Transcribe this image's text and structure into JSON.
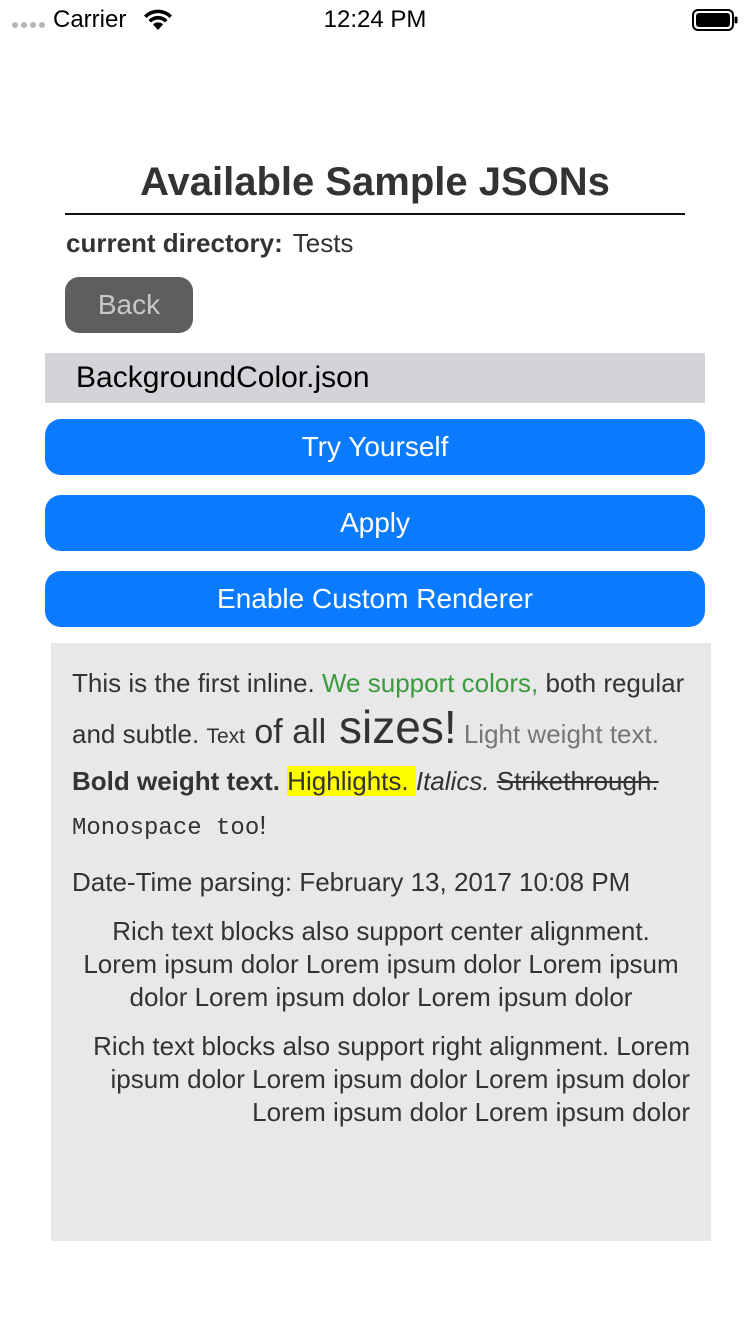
{
  "status_bar": {
    "carrier": "Carrier",
    "time": "12:24 PM"
  },
  "header": {
    "title": "Available Sample JSONs",
    "current_directory_label": "current directory:",
    "current_directory_value": "Tests"
  },
  "back_button": {
    "label": "Back"
  },
  "file": {
    "name": "BackgroundColor.json"
  },
  "buttons": {
    "try_yourself": "Try Yourself",
    "apply": "Apply",
    "custom_renderer": "Enable Custom Renderer"
  },
  "colors": {
    "accent_blue": "#0a7aff",
    "highlight": "#ffff00",
    "green_text": "#3a9a3f",
    "card_bg": "#e8e8e8",
    "file_row_bg": "#d3d3d8"
  },
  "card": {
    "rich": {
      "t1": "This is the first inline. ",
      "t2": "We support colors,",
      "t3": " both regular and subtle. ",
      "t4": "Text",
      "t5": " of ",
      "t6": "all",
      "t7": " sizes!",
      "t8": " Light weight text. ",
      "t9": "Bold weight text.",
      "t10": " ",
      "t11": "Highlights. ",
      "t12": "Italics.",
      "t13": " ",
      "t14": "Strikethrough. ",
      "t15": "Monospace too",
      "t16": "!"
    },
    "date_line": "Date-Time parsing: February 13, 2017 10:08 PM",
    "center_text": "Rich text blocks also support center alignment. Lorem ipsum dolor Lorem ipsum dolor Lorem ipsum dolor Lorem ipsum dolor Lorem ipsum dolor",
    "right_text": "Rich text blocks also support right alignment. Lorem ipsum dolor Lorem ipsum dolor Lorem ipsum dolor Lorem ipsum dolor Lorem ipsum dolor"
  }
}
